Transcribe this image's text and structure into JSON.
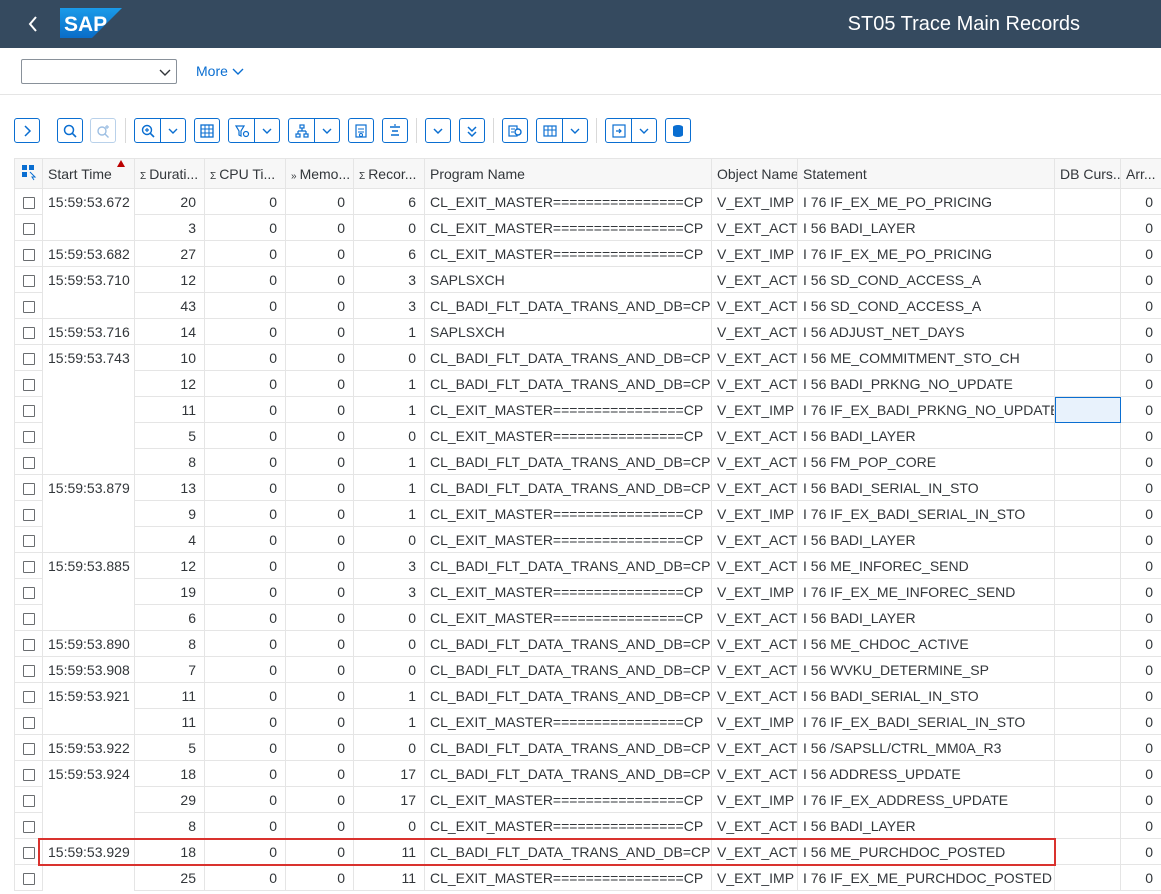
{
  "shell": {
    "title": "ST05 Trace Main Records",
    "logo_text": "SAP"
  },
  "subheader": {
    "select_value": "",
    "more_label": "More"
  },
  "toolbar": {
    "buttons": [
      "expand-arrow-icon",
      "search-icon",
      "find-next-icon",
      "zoom-in-icon",
      "calculator-icon",
      "filter-icon",
      "hierarchy-icon",
      "export-doc-icon",
      "sort-icon",
      "collapse-down-icon",
      "double-down-icon",
      "settings-icon",
      "layout-icon",
      "table-settings-icon",
      "database-icon"
    ]
  },
  "table": {
    "columns": [
      "",
      "Start Time",
      "Durati...",
      "CPU Ti...",
      "Memo...",
      "Recor...",
      "Program Name",
      "Object Name",
      "Statement",
      "DB Curs...",
      "Arr..."
    ],
    "rows": [
      {
        "time": "15:59:53.672",
        "dur": "20",
        "cpu": "0",
        "mem": "0",
        "rec": "6",
        "prog": "CL_EXIT_MASTER================CP",
        "obj": "V_EXT_IMP",
        "stmt": "I 76 IF_EX_ME_PO_PRICING",
        "db": "",
        "arr": "0"
      },
      {
        "time": "",
        "dur": "3",
        "cpu": "0",
        "mem": "0",
        "rec": "0",
        "prog": "CL_EXIT_MASTER================CP",
        "obj": "V_EXT_ACT",
        "stmt": "I 56 BADI_LAYER",
        "db": "",
        "arr": "0"
      },
      {
        "time": "15:59:53.682",
        "dur": "27",
        "cpu": "0",
        "mem": "0",
        "rec": "6",
        "prog": "CL_EXIT_MASTER================CP",
        "obj": "V_EXT_IMP",
        "stmt": "I 76 IF_EX_ME_PO_PRICING",
        "db": "",
        "arr": "0"
      },
      {
        "time": "15:59:53.710",
        "dur": "12",
        "cpu": "0",
        "mem": "0",
        "rec": "3",
        "prog": "SAPLSXCH",
        "obj": "V_EXT_ACT",
        "stmt": "I 56 SD_COND_ACCESS_A",
        "db": "",
        "arr": "0"
      },
      {
        "time": "",
        "dur": "43",
        "cpu": "0",
        "mem": "0",
        "rec": "3",
        "prog": "CL_BADI_FLT_DATA_TRANS_AND_DB=CP",
        "obj": "V_EXT_ACT",
        "stmt": "I 56 SD_COND_ACCESS_A",
        "db": "",
        "arr": "0"
      },
      {
        "time": "15:59:53.716",
        "dur": "14",
        "cpu": "0",
        "mem": "0",
        "rec": "1",
        "prog": "SAPLSXCH",
        "obj": "V_EXT_ACT",
        "stmt": "I 56 ADJUST_NET_DAYS",
        "db": "",
        "arr": "0"
      },
      {
        "time": "15:59:53.743",
        "dur": "10",
        "cpu": "0",
        "mem": "0",
        "rec": "0",
        "prog": "CL_BADI_FLT_DATA_TRANS_AND_DB=CP",
        "obj": "V_EXT_ACT",
        "stmt": "I 56 ME_COMMITMENT_STO_CH",
        "db": "",
        "arr": "0"
      },
      {
        "time": "",
        "dur": "12",
        "cpu": "0",
        "mem": "0",
        "rec": "1",
        "prog": "CL_BADI_FLT_DATA_TRANS_AND_DB=CP",
        "obj": "V_EXT_ACT",
        "stmt": "I 56 BADI_PRKNG_NO_UPDATE",
        "db": "",
        "arr": "0"
      },
      {
        "time": "",
        "dur": "11",
        "cpu": "0",
        "mem": "0",
        "rec": "1",
        "prog": "CL_EXIT_MASTER================CP",
        "obj": "V_EXT_IMP",
        "stmt": "I 76 IF_EX_BADI_PRKNG_NO_UPDATE",
        "db": "",
        "arr": "0",
        "cursor": true
      },
      {
        "time": "",
        "dur": "5",
        "cpu": "0",
        "mem": "0",
        "rec": "0",
        "prog": "CL_EXIT_MASTER================CP",
        "obj": "V_EXT_ACT",
        "stmt": "I 56 BADI_LAYER",
        "db": "",
        "arr": "0"
      },
      {
        "time": "",
        "dur": "8",
        "cpu": "0",
        "mem": "0",
        "rec": "1",
        "prog": "CL_BADI_FLT_DATA_TRANS_AND_DB=CP",
        "obj": "V_EXT_ACT",
        "stmt": "I 56 FM_POP_CORE",
        "db": "",
        "arr": "0"
      },
      {
        "time": "15:59:53.879",
        "dur": "13",
        "cpu": "0",
        "mem": "0",
        "rec": "1",
        "prog": "CL_BADI_FLT_DATA_TRANS_AND_DB=CP",
        "obj": "V_EXT_ACT",
        "stmt": "I 56 BADI_SERIAL_IN_STO",
        "db": "",
        "arr": "0"
      },
      {
        "time": "",
        "dur": "9",
        "cpu": "0",
        "mem": "0",
        "rec": "1",
        "prog": "CL_EXIT_MASTER================CP",
        "obj": "V_EXT_IMP",
        "stmt": "I 76 IF_EX_BADI_SERIAL_IN_STO",
        "db": "",
        "arr": "0"
      },
      {
        "time": "",
        "dur": "4",
        "cpu": "0",
        "mem": "0",
        "rec": "0",
        "prog": "CL_EXIT_MASTER================CP",
        "obj": "V_EXT_ACT",
        "stmt": "I 56 BADI_LAYER",
        "db": "",
        "arr": "0"
      },
      {
        "time": "15:59:53.885",
        "dur": "12",
        "cpu": "0",
        "mem": "0",
        "rec": "3",
        "prog": "CL_BADI_FLT_DATA_TRANS_AND_DB=CP",
        "obj": "V_EXT_ACT",
        "stmt": "I 56 ME_INFOREC_SEND",
        "db": "",
        "arr": "0"
      },
      {
        "time": "",
        "dur": "19",
        "cpu": "0",
        "mem": "0",
        "rec": "3",
        "prog": "CL_EXIT_MASTER================CP",
        "obj": "V_EXT_IMP",
        "stmt": "I 76 IF_EX_ME_INFOREC_SEND",
        "db": "",
        "arr": "0"
      },
      {
        "time": "",
        "dur": "6",
        "cpu": "0",
        "mem": "0",
        "rec": "0",
        "prog": "CL_EXIT_MASTER================CP",
        "obj": "V_EXT_ACT",
        "stmt": "I 56 BADI_LAYER",
        "db": "",
        "arr": "0"
      },
      {
        "time": "15:59:53.890",
        "dur": "8",
        "cpu": "0",
        "mem": "0",
        "rec": "0",
        "prog": "CL_BADI_FLT_DATA_TRANS_AND_DB=CP",
        "obj": "V_EXT_ACT",
        "stmt": "I 56 ME_CHDOC_ACTIVE",
        "db": "",
        "arr": "0"
      },
      {
        "time": "15:59:53.908",
        "dur": "7",
        "cpu": "0",
        "mem": "0",
        "rec": "0",
        "prog": "CL_BADI_FLT_DATA_TRANS_AND_DB=CP",
        "obj": "V_EXT_ACT",
        "stmt": "I 56 WVKU_DETERMINE_SP",
        "db": "",
        "arr": "0"
      },
      {
        "time": "15:59:53.921",
        "dur": "11",
        "cpu": "0",
        "mem": "0",
        "rec": "1",
        "prog": "CL_BADI_FLT_DATA_TRANS_AND_DB=CP",
        "obj": "V_EXT_ACT",
        "stmt": "I 56 BADI_SERIAL_IN_STO",
        "db": "",
        "arr": "0"
      },
      {
        "time": "",
        "dur": "11",
        "cpu": "0",
        "mem": "0",
        "rec": "1",
        "prog": "CL_EXIT_MASTER================CP",
        "obj": "V_EXT_IMP",
        "stmt": "I 76 IF_EX_BADI_SERIAL_IN_STO",
        "db": "",
        "arr": "0"
      },
      {
        "time": "15:59:53.922",
        "dur": "5",
        "cpu": "0",
        "mem": "0",
        "rec": "0",
        "prog": "CL_BADI_FLT_DATA_TRANS_AND_DB=CP",
        "obj": "V_EXT_ACT",
        "stmt": "I 56 /SAPSLL/CTRL_MM0A_R3",
        "db": "",
        "arr": "0"
      },
      {
        "time": "15:59:53.924",
        "dur": "18",
        "cpu": "0",
        "mem": "0",
        "rec": "17",
        "prog": "CL_BADI_FLT_DATA_TRANS_AND_DB=CP",
        "obj": "V_EXT_ACT",
        "stmt": "I 56 ADDRESS_UPDATE",
        "db": "",
        "arr": "0"
      },
      {
        "time": "",
        "dur": "29",
        "cpu": "0",
        "mem": "0",
        "rec": "17",
        "prog": "CL_EXIT_MASTER================CP",
        "obj": "V_EXT_IMP",
        "stmt": "I 76 IF_EX_ADDRESS_UPDATE",
        "db": "",
        "arr": "0"
      },
      {
        "time": "",
        "dur": "8",
        "cpu": "0",
        "mem": "0",
        "rec": "0",
        "prog": "CL_EXIT_MASTER================CP",
        "obj": "V_EXT_ACT",
        "stmt": "I 56 BADI_LAYER",
        "db": "",
        "arr": "0"
      },
      {
        "time": "15:59:53.929",
        "dur": "18",
        "cpu": "0",
        "mem": "0",
        "rec": "11",
        "prog": "CL_BADI_FLT_DATA_TRANS_AND_DB=CP",
        "obj": "V_EXT_ACT",
        "stmt": "I 56 ME_PURCHDOC_POSTED",
        "db": "",
        "arr": "0",
        "highlight": true
      },
      {
        "time": "",
        "dur": "25",
        "cpu": "0",
        "mem": "0",
        "rec": "11",
        "prog": "CL_EXIT_MASTER================CP",
        "obj": "V_EXT_IMP",
        "stmt": "I 76 IF_EX_ME_PURCHDOC_POSTED",
        "db": "",
        "arr": "0"
      }
    ]
  },
  "colors": {
    "shell_bg": "#354a5f",
    "accent": "#0a6ed1",
    "highlight_border": "#d9322e",
    "sort_indicator": "#bb0000"
  }
}
